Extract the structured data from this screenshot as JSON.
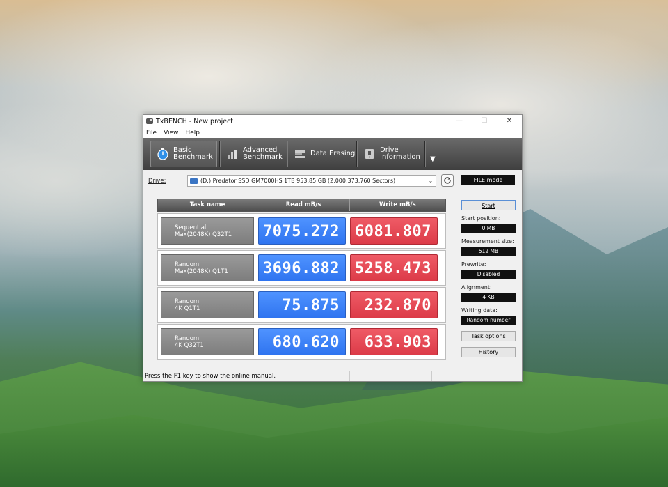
{
  "window": {
    "title": "TxBENCH - New project"
  },
  "titlebar_controls": {
    "minimize": "—",
    "maximize": "☐",
    "close": "✕"
  },
  "menu": [
    "File",
    "View",
    "Help"
  ],
  "toolbar": {
    "buttons": [
      {
        "line1": "Basic",
        "line2": "Benchmark",
        "icon": "stopwatch-icon",
        "active": true
      },
      {
        "line1": "Advanced",
        "line2": "Benchmark",
        "icon": "bar-chart-icon",
        "active": false
      },
      {
        "line1": "Data Erasing",
        "line2": "",
        "icon": "eraser-icon",
        "active": false
      },
      {
        "line1": "Drive",
        "line2": "Information",
        "icon": "drive-info-icon",
        "active": false
      }
    ],
    "dropdown": "▼"
  },
  "drive": {
    "label": "Drive:",
    "value": "(D:) Predator SSD GM7000HS 1TB  953.85 GB (2,000,373,760 Sectors)",
    "mode": "FILE mode"
  },
  "table": {
    "headers": [
      "Task name",
      "Read mB/s",
      "Write mB/s"
    ],
    "rows": [
      {
        "task_line1": "Sequential",
        "task_line2": "Max(2048K) Q32T1",
        "read": "7075.272",
        "write": "6081.807"
      },
      {
        "task_line1": "Random",
        "task_line2": "Max(2048K) Q1T1",
        "read": "3696.882",
        "write": "5258.473"
      },
      {
        "task_line1": "Random",
        "task_line2": "4K Q1T1",
        "read": "75.875",
        "write": "232.870"
      },
      {
        "task_line1": "Random",
        "task_line2": "4K Q32T1",
        "read": "680.620",
        "write": "633.903"
      }
    ]
  },
  "settings": {
    "start_label": "Start",
    "start_position_label": "Start position:",
    "start_position_value": "0 MB",
    "measurement_size_label": "Measurement size:",
    "measurement_size_value": "512 MB",
    "prewrite_label": "Prewrite:",
    "prewrite_value": "Disabled",
    "alignment_label": "Alignment:",
    "alignment_value": "4 KB",
    "writing_data_label": "Writing data:",
    "writing_data_value": "Random number",
    "task_options_label": "Task options",
    "history_label": "History"
  },
  "status": {
    "text": "Press the F1 key to show the online manual."
  },
  "colors": {
    "read": "#3b82f6",
    "write": "#e64553",
    "toolbar": "#4a4a4a"
  }
}
